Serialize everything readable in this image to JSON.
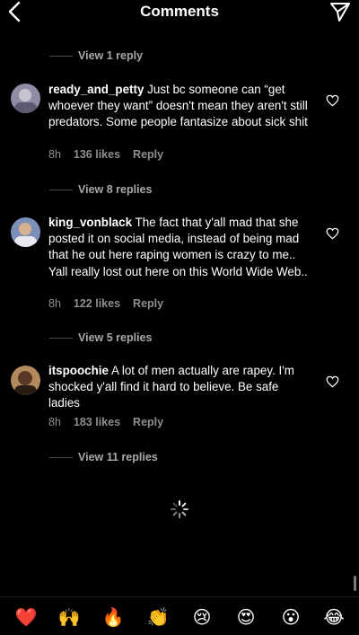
{
  "header": {
    "title": "Comments"
  },
  "threads": [
    {
      "view_replies": "View 1 reply"
    },
    {
      "comment": {
        "username": "ready_and_petty",
        "text": "Just bc someone can “get whoever they want” doesn't mean they aren't still predators. Some people fantasize about sick shit",
        "time": "8h",
        "likes": "136 likes",
        "reply": "Reply"
      },
      "view_replies": "View 8 replies"
    },
    {
      "comment": {
        "username": "king_vonblack",
        "text": "The fact that y'all mad that she posted it on social media, instead of being mad that he out here raping women is crazy to me.. Yall really lost out here on this World Wide Web..",
        "time": "8h",
        "likes": "122 likes",
        "reply": "Reply"
      },
      "view_replies": "View 5 replies"
    },
    {
      "comment": {
        "username": "itspoochie",
        "text": "A lot of men actually are rapey. I'm shocked y'all find it hard to believe. Be safe ladies",
        "time": "8h",
        "likes": "183 likes",
        "reply": "Reply"
      },
      "view_replies": "View 11 replies"
    }
  ],
  "emoji_bar": [
    "❤️",
    "🙌",
    "🔥",
    "👏",
    "😢",
    "😍",
    "😮",
    "😂"
  ],
  "icons": {
    "back": "chevron-left-icon",
    "send": "paper-plane-icon",
    "like": "heart-outline-icon",
    "loading": "spinner-icon"
  },
  "colors": {
    "background": "#000000",
    "secondary_text": "#8e8e8e",
    "reply_link": "#a8a8a8"
  }
}
